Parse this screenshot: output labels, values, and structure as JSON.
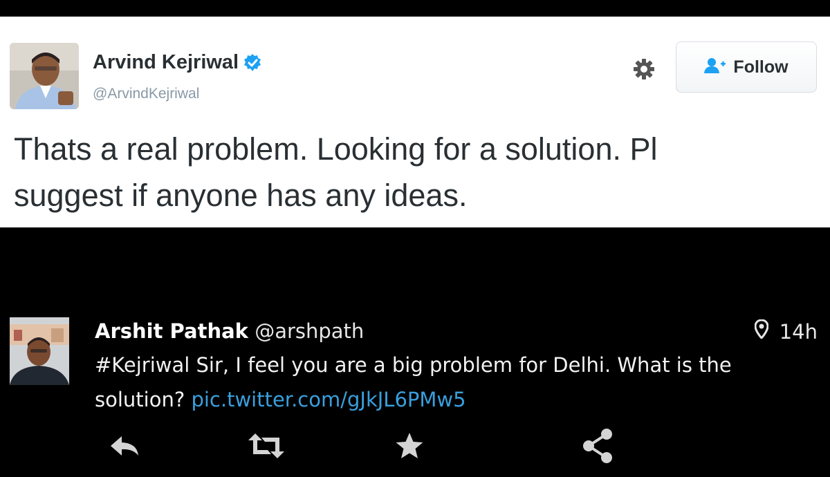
{
  "tweet": {
    "author_name": "Arvind Kejriwal",
    "handle": "@ArvindKejriwal",
    "follow_label": "Follow",
    "text": "Thats a real problem. Looking for a solution. Pl\nsuggest if anyone has any ideas.",
    "icons": [
      "verified-badge-icon",
      "gear-icon",
      "add-user-icon"
    ]
  },
  "reply": {
    "author_name": "Arshit Pathak",
    "handle": "@arshpath",
    "time": "14h",
    "text": "#Kejriwal Sir, I feel you are a big problem for Delhi. What is the solution?",
    "link": "pic.twitter.com/gJkJL6PMw5",
    "actions": [
      "reply-icon",
      "retweet-icon",
      "favorite-icon",
      "share-icon"
    ],
    "icons": [
      "location-pin-icon"
    ]
  },
  "colors": {
    "verified": "#1da1f2",
    "link": "#3a9fdd",
    "background_dark": "#000000",
    "card_white": "#ffffff"
  }
}
